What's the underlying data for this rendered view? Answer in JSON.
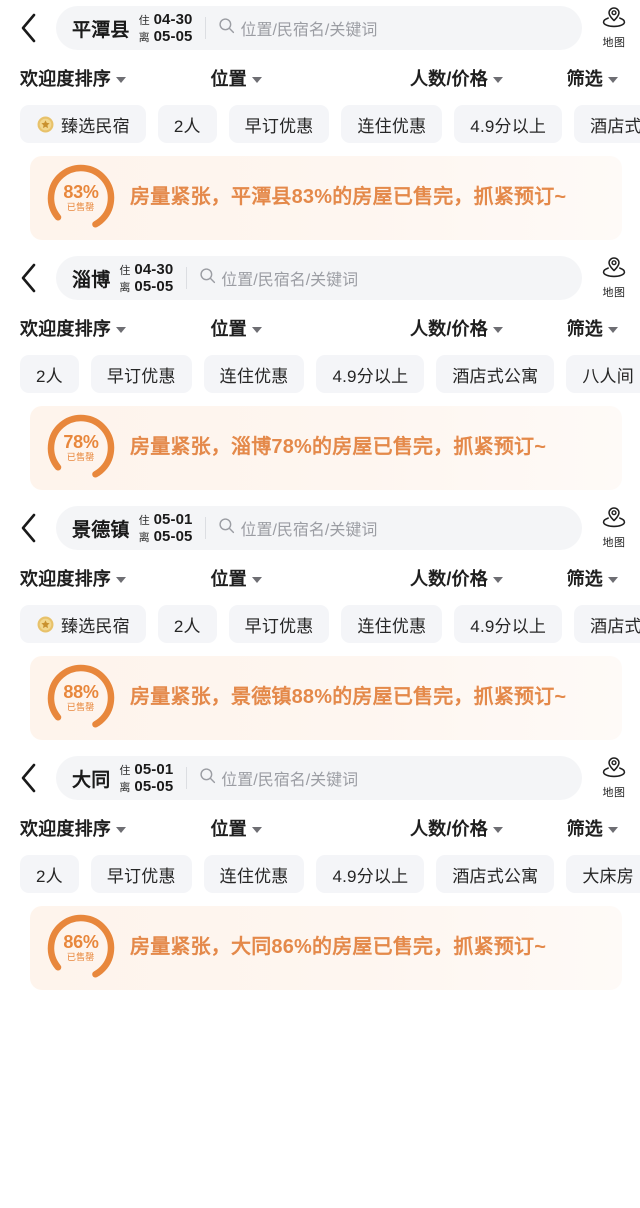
{
  "common": {
    "back_icon": "chevron-left-icon",
    "search_icon": "search-icon",
    "map_icon": "map-pin-icon",
    "map_label": "地图",
    "search_placeholder": "位置/民宿名/关键词",
    "checkin_label": "住",
    "checkout_label": "离",
    "select_badge_icon": "gold-medal-icon",
    "sold_out_label": "已售罄",
    "accent_orange": "#E8873C",
    "banner_text_color": "#E4894A",
    "banner_bg": "#FEF4EC",
    "chip_bg": "#F4F5F8",
    "pill_bg": "#F4F5F7"
  },
  "sort_options": [
    {
      "label": "欢迎度排序",
      "caret": "chevron-down-icon"
    },
    {
      "label": "位置",
      "caret": "chevron-down-icon"
    },
    {
      "label": "人数/价格",
      "caret": "chevron-down-icon"
    },
    {
      "label": "筛选",
      "caret": "chevron-down-icon"
    }
  ],
  "sections": [
    {
      "city": "平潭县",
      "checkin": "04-30",
      "checkout": "05-05",
      "chips": [
        {
          "label": "臻选民宿",
          "badge": true
        },
        {
          "label": "2人",
          "badge": false
        },
        {
          "label": "早订优惠",
          "badge": false
        },
        {
          "label": "连住优惠",
          "badge": false
        },
        {
          "label": "4.9分以上",
          "badge": false
        },
        {
          "label": "酒店式公寓",
          "badge": false
        }
      ],
      "banner": {
        "percent": "83%",
        "percent_value": 83,
        "sold_out_label": "已售罄",
        "message": "房量紧张，平潭县83%的房屋已售完，抓紧预订~"
      }
    },
    {
      "city": "淄博",
      "checkin": "04-30",
      "checkout": "05-05",
      "chips": [
        {
          "label": "2人",
          "badge": false
        },
        {
          "label": "早订优惠",
          "badge": false
        },
        {
          "label": "连住优惠",
          "badge": false
        },
        {
          "label": "4.9分以上",
          "badge": false
        },
        {
          "label": "酒店式公寓",
          "badge": false
        },
        {
          "label": "八人间",
          "badge": false
        }
      ],
      "banner": {
        "percent": "78%",
        "percent_value": 78,
        "sold_out_label": "已售罄",
        "message": "房量紧张，淄博78%的房屋已售完，抓紧预订~"
      }
    },
    {
      "city": "景德镇",
      "checkin": "05-01",
      "checkout": "05-05",
      "chips": [
        {
          "label": "臻选民宿",
          "badge": true
        },
        {
          "label": "2人",
          "badge": false
        },
        {
          "label": "早订优惠",
          "badge": false
        },
        {
          "label": "连住优惠",
          "badge": false
        },
        {
          "label": "4.9分以上",
          "badge": false
        },
        {
          "label": "酒店式公寓",
          "badge": false
        }
      ],
      "banner": {
        "percent": "88%",
        "percent_value": 88,
        "sold_out_label": "已售罄",
        "message": "房量紧张，景德镇88%的房屋已售完，抓紧预订~"
      }
    },
    {
      "city": "大同",
      "checkin": "05-01",
      "checkout": "05-05",
      "chips": [
        {
          "label": "2人",
          "badge": false
        },
        {
          "label": "早订优惠",
          "badge": false
        },
        {
          "label": "连住优惠",
          "badge": false
        },
        {
          "label": "4.9分以上",
          "badge": false
        },
        {
          "label": "酒店式公寓",
          "badge": false
        },
        {
          "label": "大床房",
          "badge": false
        }
      ],
      "banner": {
        "percent": "86%",
        "percent_value": 86,
        "sold_out_label": "已售罄",
        "message": "房量紧张，大同86%的房屋已售完，抓紧预订~"
      }
    }
  ]
}
